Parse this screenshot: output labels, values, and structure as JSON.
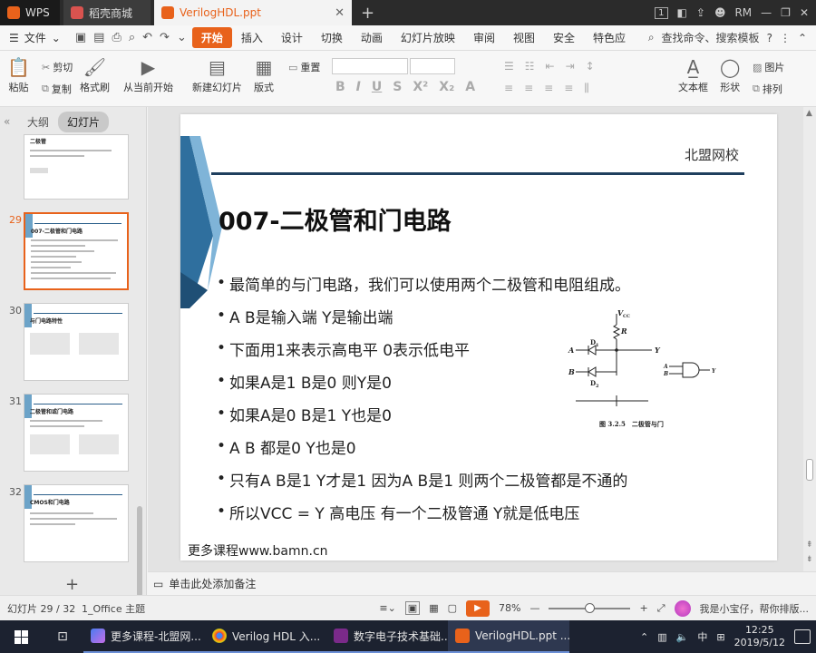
{
  "titlebar": {
    "wps_tab": "WPS",
    "daoke_tab": "稻壳商城",
    "doc_tab": "VerilogHDL.ppt",
    "user": "RM",
    "badge": "1"
  },
  "menubar": {
    "file": "文件",
    "items": [
      "开始",
      "插入",
      "设计",
      "切换",
      "动画",
      "幻灯片放映",
      "审阅",
      "视图",
      "安全",
      "特色应"
    ],
    "search": "查找命令、搜索模板"
  },
  "ribbon": {
    "paste": "粘贴",
    "cut": "剪切",
    "copy": "复制",
    "format_painter": "格式刷",
    "from_current": "从当前开始",
    "new_slide": "新建幻灯片",
    "layout": "版式",
    "reset": "重置",
    "textbox": "文本框",
    "shape": "形状",
    "picture": "图片",
    "arrange": "排列"
  },
  "leftpane": {
    "tab_outline": "大纲",
    "tab_slides": "幻灯片",
    "thumbs": [
      {
        "num": "",
        "title": "二极管"
      },
      {
        "num": "29",
        "title": "007-二极管和门电路"
      },
      {
        "num": "30",
        "title": "与门电路特性"
      },
      {
        "num": "31",
        "title": "二极管和或门电路"
      },
      {
        "num": "32",
        "title": "CMOS和门电路"
      }
    ]
  },
  "slide": {
    "header": "北盟网校",
    "title": "007-二极管和门电路",
    "bullets": [
      "最简单的与门电路，我们可以使用两个二极管和电阻组成。",
      "A B是输入端 Y是输出端",
      "下面用1来表示高电平 0表示低电平",
      "如果A是1 B是0 则Y是0",
      "如果A是0 B是1 Y也是0",
      "A B 都是0 Y也是0",
      "只有A B是1 Y才是1 因为A B是1 则两个二极管都是不通的",
      "所以VCC = Y 高电压 有一个二极管通 Y就是低电压"
    ],
    "footer": "更多课程www.bamn.cn",
    "figure": {
      "vcc": "V",
      "vcc_sub": "CC",
      "r": "R",
      "d1": "D",
      "d1_sub": "1",
      "d2": "D",
      "d2_sub": "2",
      "a": "A",
      "b": "B",
      "y": "Y",
      "gate_a": "A",
      "gate_b": "B",
      "gate_y": "Y",
      "caption": "图 3.2.5　二极管与门"
    }
  },
  "notes": {
    "placeholder": "单击此处添加备注"
  },
  "status": {
    "slide_info": "幻灯片 29 / 32",
    "theme": "1_Office 主题",
    "zoom": "78%",
    "assistant": "我是小宝仔，帮你排版..."
  },
  "taskbar": {
    "tasks": [
      "更多课程-北盟网...",
      "Verilog HDL 入...",
      "数字电子技术基础...",
      "VerilogHDL.ppt ..."
    ],
    "ime": "中",
    "time": "12:25",
    "date": "2019/5/12"
  },
  "colors": {
    "accent": "#e8621b",
    "slide_rule": "#1f3f5e",
    "slide_band": "#2f6f9e"
  }
}
